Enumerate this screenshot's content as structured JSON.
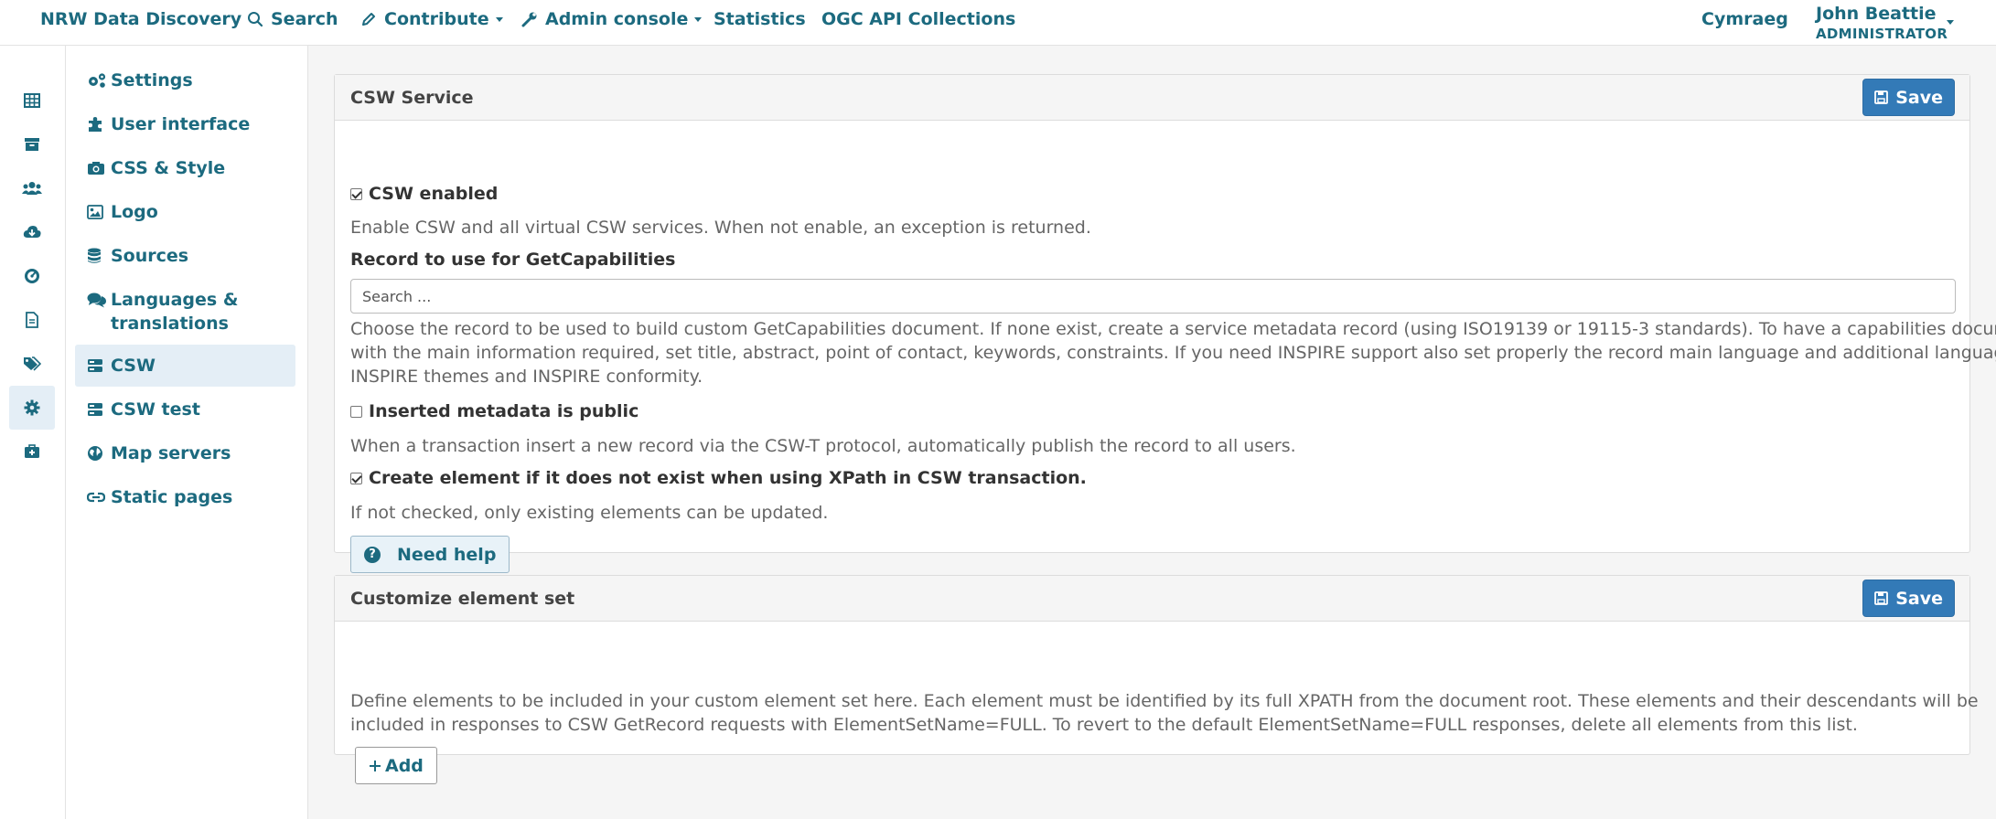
{
  "navbar": {
    "brand": "NRW Data Discovery",
    "search": "Search",
    "contribute": "Contribute",
    "admin_console": "Admin console",
    "statistics": "Statistics",
    "ogc": "OGC API Collections",
    "language": "Cymraeg",
    "user_name": "John Beattie",
    "user_role": "ADMINISTRATOR"
  },
  "rail": {
    "icons": [
      "grid-icon",
      "archive-icon",
      "users-icon",
      "cloud-download-icon",
      "dashboard-icon",
      "file-icon",
      "tags-icon",
      "gear-icon",
      "medkit-icon"
    ],
    "active": "gear-icon"
  },
  "sidebar": {
    "items": [
      {
        "label": "Settings",
        "icon": "cogs-icon"
      },
      {
        "label": "User interface",
        "icon": "puzzle-icon"
      },
      {
        "label": "CSS & Style",
        "icon": "camera-icon"
      },
      {
        "label": "Logo",
        "icon": "image-icon"
      },
      {
        "label": "Sources",
        "icon": "database-icon"
      },
      {
        "label": "Languages & translations",
        "icon": "comments-icon"
      },
      {
        "label": "CSW",
        "icon": "server-icon"
      },
      {
        "label": "CSW test",
        "icon": "server-icon"
      },
      {
        "label": "Map servers",
        "icon": "globe-icon"
      },
      {
        "label": "Static pages",
        "icon": "link-icon"
      }
    ],
    "active": "CSW"
  },
  "csw_panel": {
    "title": "CSW Service",
    "save_label": "Save",
    "csw_enabled": {
      "label": "CSW enabled",
      "checked": true,
      "help": "Enable CSW and all virtual CSW services. When not enable, an exception is returned."
    },
    "record_label": "Record to use for GetCapabilities",
    "record_placeholder": "Search ...",
    "record_help_1": "Choose the record to be used to build custom GetCapabilities document. If none exist, create a service metadata record (using ISO19139 or 19115-3 standards). To have a capabilities document",
    "record_help_2": "with the main information required, set title, abstract, point of contact, keywords, constraints. If you need INSPIRE support also set properly the record main language and additional languages,",
    "record_help_3": "INSPIRE themes and INSPIRE conformity.",
    "inserted_public": {
      "label": "Inserted metadata is public",
      "checked": false,
      "help": "When a transaction insert a new record via the CSW-T protocol, automatically publish the record to all users."
    },
    "create_element": {
      "label": "Create element if it does not exist when using XPath in CSW transaction.",
      "checked": true,
      "help": "If not checked, only existing elements can be updated."
    },
    "help_button": "Need help"
  },
  "element_panel": {
    "title": "Customize element set",
    "save_label": "Save",
    "help_1": "Define elements to be included in your custom element set here. Each element must be identified by its full XPATH from the document root. These elements and their descendants will be",
    "help_2": "included in responses to CSW GetRecord requests with ElementSetName=FULL. To revert to the default ElementSetName=FULL responses, delete all elements from this list.",
    "add_label": "Add"
  },
  "colors": {
    "accent": "#1c6a7f",
    "primary": "#337ab7",
    "active_bg": "#e4eef6"
  }
}
